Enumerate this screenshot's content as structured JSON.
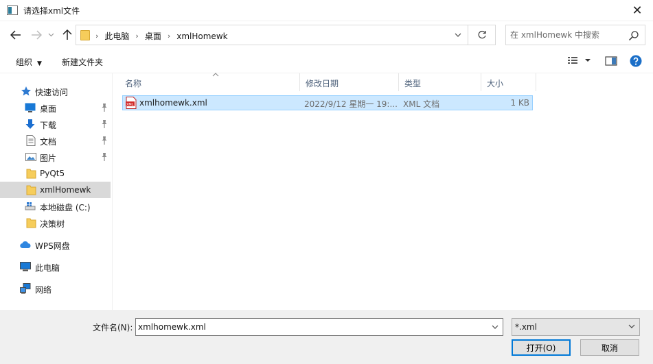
{
  "window": {
    "title": "请选择xml文件",
    "close_glyph": "✕"
  },
  "address": {
    "breadcrumbs": [
      "此电脑",
      "桌面",
      "xmlHomewk"
    ],
    "separator": "›"
  },
  "search": {
    "placeholder": "在 xmlHomewk 中搜索"
  },
  "toolbar": {
    "organize_label": "组织",
    "new_folder_label": "新建文件夹"
  },
  "sidebar": {
    "items": [
      {
        "label": "快速访问",
        "icon": "star-icon"
      },
      {
        "label": "桌面",
        "icon": "desktop-icon",
        "pinned": true
      },
      {
        "label": "下载",
        "icon": "download-icon",
        "pinned": true
      },
      {
        "label": "文档",
        "icon": "document-icon",
        "pinned": true
      },
      {
        "label": "图片",
        "icon": "picture-icon",
        "pinned": true
      },
      {
        "label": "PyQt5",
        "icon": "folder-icon"
      },
      {
        "label": "xmlHomewk",
        "icon": "folder-icon",
        "selected": true
      },
      {
        "label": "本地磁盘 (C:)",
        "icon": "drive-icon"
      },
      {
        "label": "决策树",
        "icon": "folder-icon"
      },
      {
        "label": "WPS网盘",
        "icon": "cloud-icon"
      },
      {
        "label": "此电脑",
        "icon": "computer-icon"
      },
      {
        "label": "网络",
        "icon": "network-icon"
      }
    ]
  },
  "columns": {
    "name": "名称",
    "modified": "修改日期",
    "type": "类型",
    "size": "大小"
  },
  "files": [
    {
      "name": "xmlhomewk.xml",
      "modified": "2022/9/12 星期一 19:...",
      "type": "XML 文档",
      "size": "1 KB"
    }
  ],
  "footer": {
    "filename_label": "文件名(N):",
    "filename_value": "xmlhomewk.xml",
    "filter_value": "*.xml",
    "open_label": "打开(O)",
    "cancel_label": "取消"
  },
  "colors": {
    "selection": "#cce8ff",
    "accent": "#0078d7",
    "folder": "#f6cd5b"
  }
}
